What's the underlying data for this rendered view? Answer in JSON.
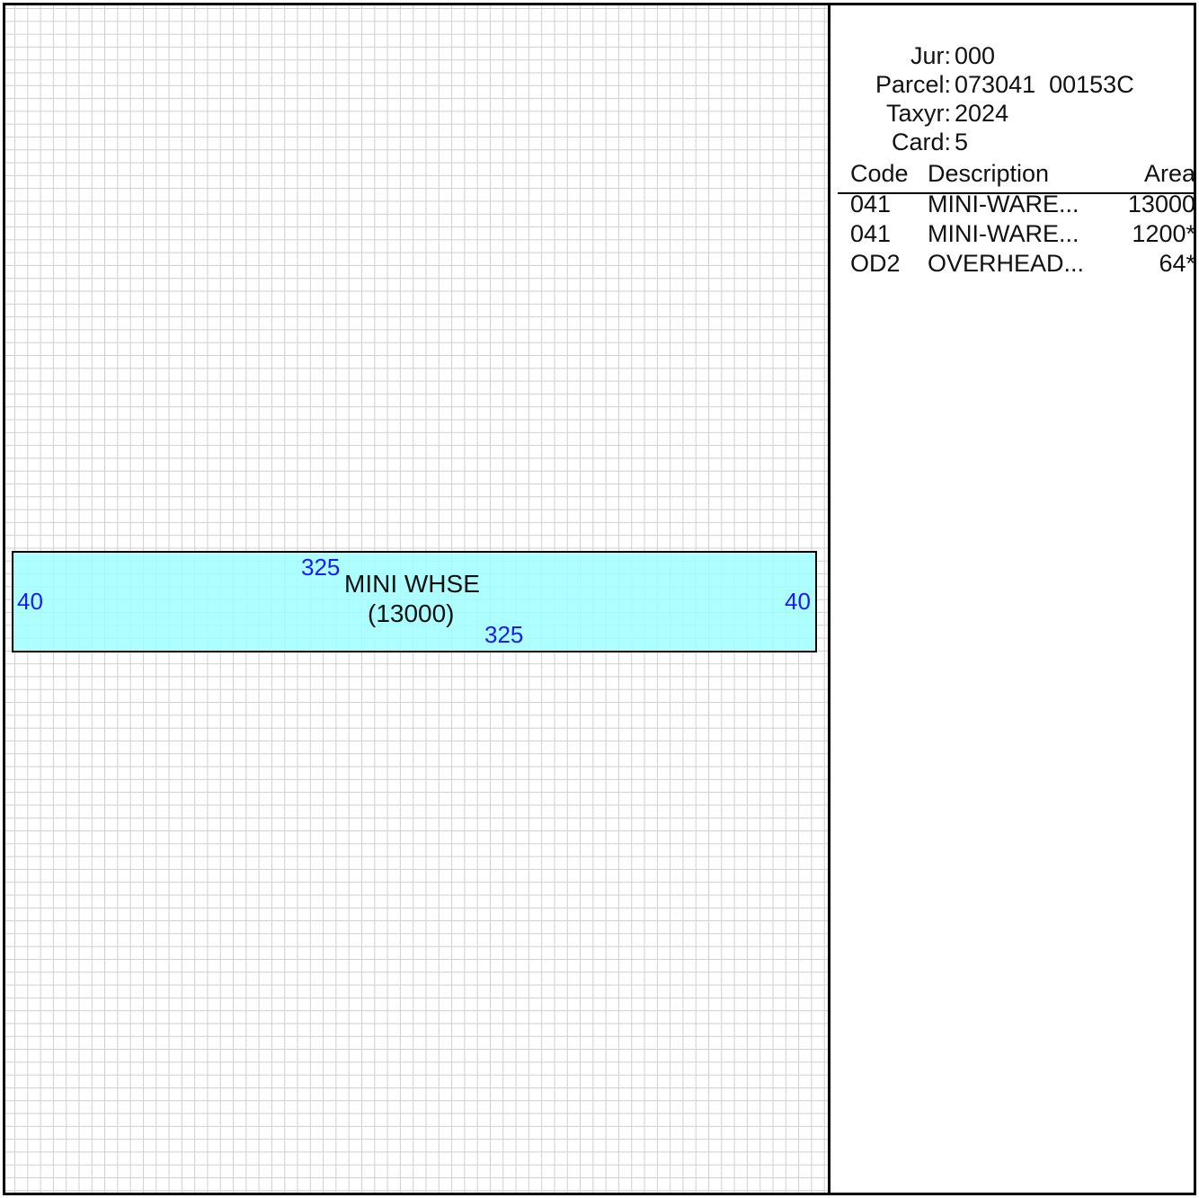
{
  "header": {
    "jur_label": "Jur:",
    "jur_value": "000",
    "parcel_label": "Parcel:",
    "parcel_value": "073041  00153C",
    "taxyr_label": "Taxyr:",
    "taxyr_value": "2024",
    "card_label": "Card:",
    "card_value": "5"
  },
  "table": {
    "headers": {
      "code": "Code",
      "description": "Description",
      "area": "Area"
    },
    "rows": [
      {
        "code": "041",
        "description": "MINI-WARE...",
        "area": "13000"
      },
      {
        "code": "041",
        "description": "MINI-WARE...",
        "area": "1200*"
      },
      {
        "code": "OD2",
        "description": "OVERHEAD...",
        "area": "64*"
      }
    ]
  },
  "sketch": {
    "building_name": "MINI WHSE",
    "building_area": "(13000)",
    "dim_top": "325",
    "dim_bottom": "325",
    "dim_left": "40",
    "dim_right": "40",
    "fill_color": "#a0ffff",
    "dimension_color": "#1a1aff"
  }
}
